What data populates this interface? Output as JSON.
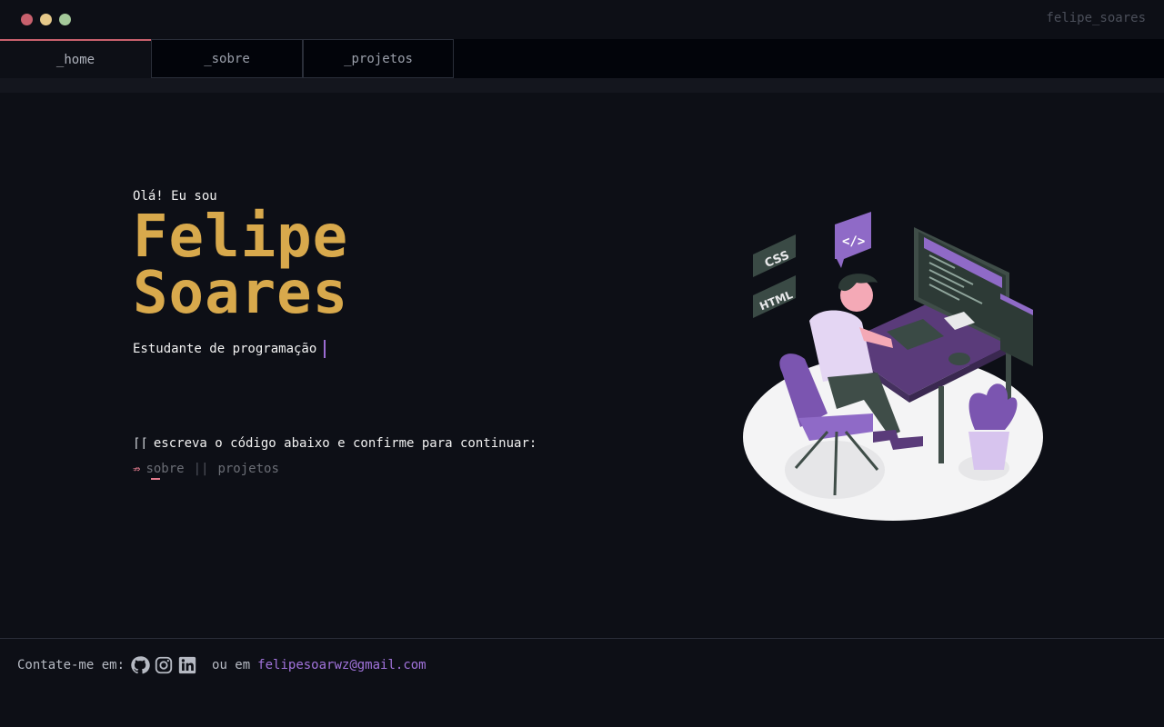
{
  "window": {
    "brand": "felipe_soares"
  },
  "tabs": [
    {
      "label": "_home",
      "active": true
    },
    {
      "label": "_sobre",
      "active": false
    },
    {
      "label": "_projetos",
      "active": false
    }
  ],
  "hero": {
    "greeting": "Olá! Eu sou",
    "first_name": "Felipe",
    "last_name": "Soares",
    "role": "Estudante de programação"
  },
  "prompt": {
    "bracket": "⌈⌈",
    "text": "escreva o código abaixo e confirme para continuar:",
    "arrow": "⇏",
    "option1": "sobre",
    "separator": "||",
    "option2": "projetos"
  },
  "illustration": {
    "css_label": "CSS",
    "html_label": "HTML",
    "code_label": "</>"
  },
  "footer": {
    "contact_label": "Contate-me em:",
    "or_label": "ou em",
    "email": "felipesoarwz@gmail.com",
    "icons": [
      "github-icon",
      "instagram-icon",
      "linkedin-icon"
    ]
  },
  "colors": {
    "accent_gold": "#d8a94c",
    "accent_purple": "#a173db",
    "accent_red": "#c8606d"
  }
}
